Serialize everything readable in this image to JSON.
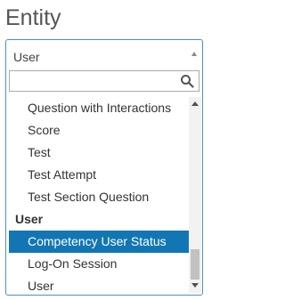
{
  "heading": "Entity",
  "select": {
    "selected_value": "User",
    "search": {
      "value": "",
      "placeholder": ""
    }
  },
  "options": [
    {
      "label": "Question with Interactions",
      "type": "option"
    },
    {
      "label": "Score",
      "type": "option"
    },
    {
      "label": "Test",
      "type": "option"
    },
    {
      "label": "Test Attempt",
      "type": "option"
    },
    {
      "label": "Test Section Question",
      "type": "option"
    },
    {
      "label": "User",
      "type": "group"
    },
    {
      "label": "Competency User Status",
      "type": "option",
      "highlighted": true
    },
    {
      "label": "Log-On Session",
      "type": "option"
    },
    {
      "label": "User",
      "type": "option"
    }
  ],
  "colors": {
    "highlight_bg": "#1276b4",
    "highlight_text": "#ffffff",
    "border_focus": "#4a90c8"
  },
  "icons": {
    "search": "search-icon",
    "dropdown": "chevron-up-icon",
    "scroll_up": "scroll-up-arrow-icon",
    "scroll_down": "scroll-down-arrow-icon"
  }
}
